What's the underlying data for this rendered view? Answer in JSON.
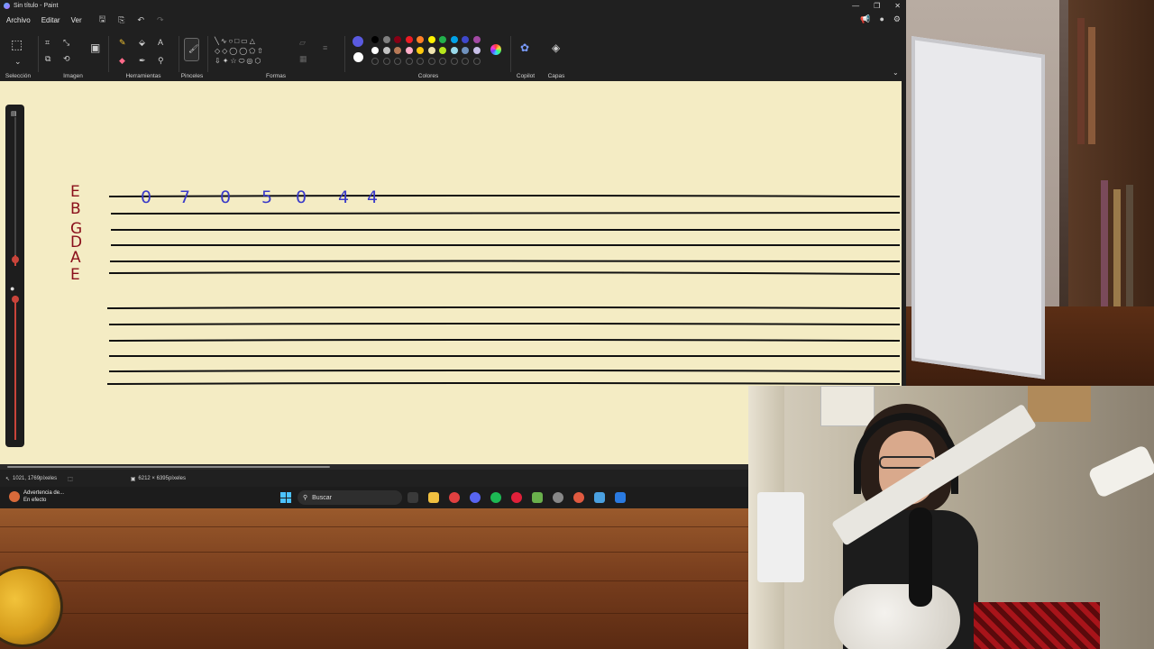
{
  "window": {
    "title": "Sin título - Paint"
  },
  "menu": {
    "file": "Archivo",
    "edit": "Editar",
    "view": "Ver"
  },
  "ribbon": {
    "selection": "Selección",
    "image": "Imagen",
    "tools": "Herramientas",
    "brushes": "Pinceles",
    "shapes": "Formas",
    "colors": "Colores",
    "copilot": "Copilot",
    "layers": "Capas"
  },
  "palette": {
    "primary": "#5a5ae0",
    "secondary": "#ffffff",
    "row1": [
      "#000000",
      "#7f7f7f",
      "#880015",
      "#ed1c24",
      "#ff7f27",
      "#fff200",
      "#22b14c",
      "#00a2e8",
      "#3f48cc",
      "#a349a4"
    ],
    "row2": [
      "#ffffff",
      "#c3c3c3",
      "#b97a57",
      "#ffaec9",
      "#ffc90e",
      "#efe4b0",
      "#b5e61d",
      "#99d9ea",
      "#7092be",
      "#c8bfe7"
    ]
  },
  "tab": {
    "string_letters": [
      "E",
      "B",
      "G",
      "D",
      "A",
      "E"
    ],
    "fret_numbers": [
      "0",
      "7",
      "0",
      "5",
      "0",
      "4",
      "4"
    ]
  },
  "status": {
    "cursor": "1021, 1769píxeles",
    "canvas_size": "6212 × 6395píxeles"
  },
  "taskbar": {
    "notification_title": "Advertencia de...",
    "notification_subtitle": "En efecto",
    "search_placeholder": "Buscar"
  }
}
